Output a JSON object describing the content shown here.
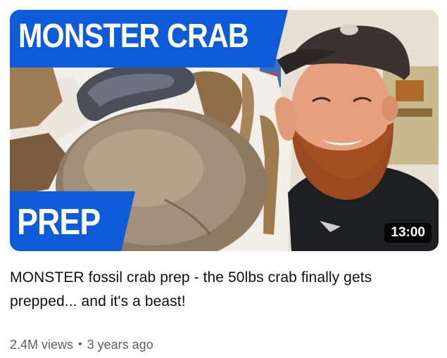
{
  "video": {
    "thumbnail": {
      "banner_top_text": "MONSTER CRAB",
      "banner_bottom_text": "PREP",
      "banner_color": "#0d5bd8",
      "duration": "13:00"
    },
    "title": "MONSTER fossil crab prep - the 50lbs crab finally gets prepped... and it's a beast!",
    "views": "2.4M views",
    "separator": "•",
    "age": "3 years ago"
  }
}
